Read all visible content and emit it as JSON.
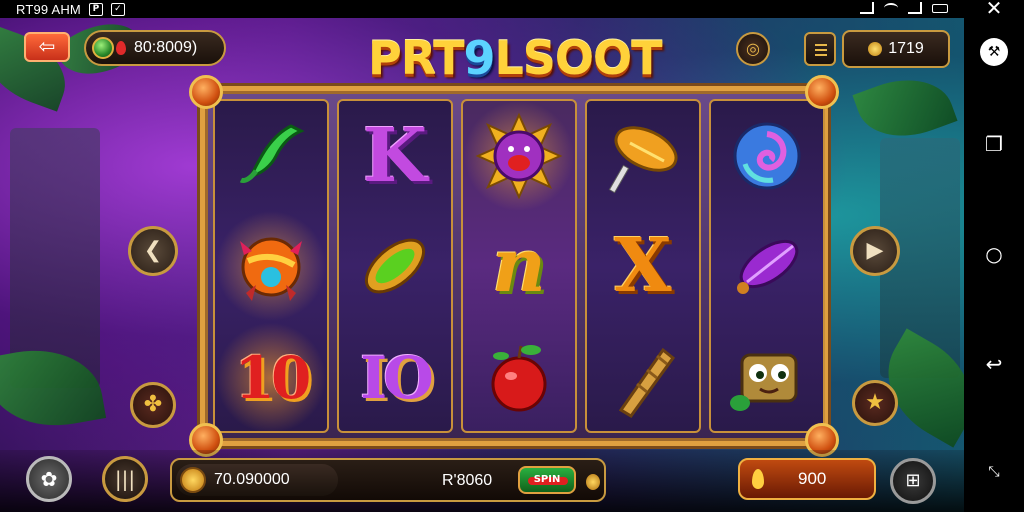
{
  "status_bar": {
    "title": "RT99 AHM",
    "icons": [
      "p-icon",
      "check-icon",
      "signal-icon",
      "wifi-icon",
      "signal-icon",
      "battery-icon"
    ]
  },
  "header": {
    "back_icon": "arrow-left-icon",
    "balance": "80:8009)",
    "logo_text_a": "PRT",
    "logo_text_b": "9",
    "logo_text_c": "LSOOT",
    "coins": "1719"
  },
  "reels": [
    [
      {
        "symbol": "leaf-horn",
        "kind": "icon"
      },
      {
        "symbol": "spiked-orb",
        "kind": "icon"
      },
      {
        "symbol": "10",
        "kind": "ten-red"
      }
    ],
    [
      {
        "symbol": "K",
        "kind": "letter-k"
      },
      {
        "symbol": "gem-leaf",
        "kind": "icon"
      },
      {
        "symbol": "IO",
        "kind": "ten-purple"
      }
    ],
    [
      {
        "symbol": "sun-face",
        "kind": "icon"
      },
      {
        "symbol": "n",
        "kind": "letter-n"
      },
      {
        "symbol": "apple",
        "kind": "icon"
      }
    ],
    [
      {
        "symbol": "shell-hammer",
        "kind": "icon"
      },
      {
        "symbol": "X",
        "kind": "letter-x"
      },
      {
        "symbol": "horn",
        "kind": "icon"
      }
    ],
    [
      {
        "symbol": "swirl-orb",
        "kind": "icon"
      },
      {
        "symbol": "purple-leaf",
        "kind": "icon"
      },
      {
        "symbol": "box-creature",
        "kind": "icon"
      }
    ]
  ],
  "bottom": {
    "bet_value": "70.090000",
    "win_label": "R'8060",
    "spin_badge": "SPIN",
    "total": "900"
  },
  "colors": {
    "gold_border": "#c89a40",
    "accent_orange": "#c04a10",
    "bg_purple": "#5a1f86",
    "bg_teal": "#155a70"
  }
}
